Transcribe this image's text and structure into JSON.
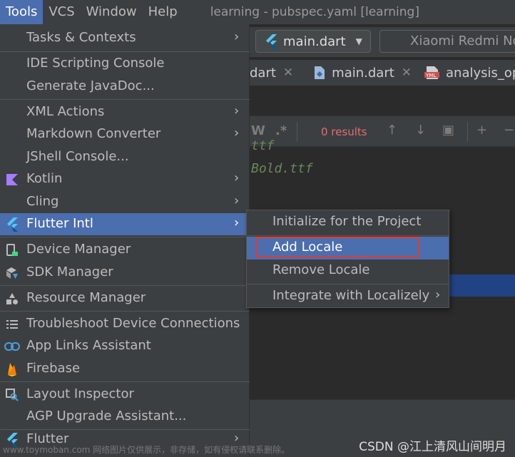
{
  "menubar": {
    "items": [
      "Tools",
      "VCS",
      "Window",
      "Help"
    ],
    "title": "learning - pubspec.yaml [learning]"
  },
  "toolbar": {
    "run_config": "main.dart",
    "device": "Xiaomi Redmi Note"
  },
  "tabs": [
    {
      "label": "dart",
      "icon": "dart-file-icon"
    },
    {
      "label": "main.dart",
      "icon": "dart-file-icon"
    },
    {
      "label": "analysis_opt",
      "icon": "yml-file-icon"
    }
  ],
  "findbar": {
    "words_toggle": "W",
    "regex_toggle": ".*",
    "results": "0 results"
  },
  "editor": {
    "line1": "ttf",
    "line2": "Bold.ttf"
  },
  "tools_menu": {
    "items": [
      {
        "label": "Tasks & Contexts",
        "submenu": true,
        "icon": ""
      },
      {
        "label": "IDE Scripting Console",
        "submenu": false,
        "icon": ""
      },
      {
        "label": "Generate JavaDoc...",
        "submenu": false,
        "icon": ""
      },
      {
        "label": "XML Actions",
        "submenu": true,
        "icon": ""
      },
      {
        "label": "Markdown Converter",
        "submenu": true,
        "icon": ""
      },
      {
        "label": "JShell Console...",
        "submenu": false,
        "icon": ""
      },
      {
        "label": "Kotlin",
        "submenu": true,
        "icon": "kotlin-icon"
      },
      {
        "label": "Cling",
        "submenu": true,
        "icon": ""
      },
      {
        "label": "Flutter Intl",
        "submenu": true,
        "icon": "flutter-icon"
      },
      {
        "label": "Device Manager",
        "submenu": false,
        "icon": "device-manager-icon"
      },
      {
        "label": "SDK Manager",
        "submenu": false,
        "icon": "sdk-manager-icon"
      },
      {
        "label": "Resource Manager",
        "submenu": false,
        "icon": "resource-manager-icon"
      },
      {
        "label": "Troubleshoot Device Connections",
        "submenu": false,
        "icon": "list-icon"
      },
      {
        "label": "App Links Assistant",
        "submenu": false,
        "icon": "link-icon"
      },
      {
        "label": "Firebase",
        "submenu": false,
        "icon": "firebase-icon"
      },
      {
        "label": "Layout Inspector",
        "submenu": false,
        "icon": "layout-inspector-icon"
      },
      {
        "label": "AGP Upgrade Assistant...",
        "submenu": false,
        "icon": ""
      },
      {
        "label": "Flutter",
        "submenu": true,
        "icon": "flutter-icon"
      }
    ]
  },
  "flutter_intl_submenu": {
    "items": [
      {
        "label": "Initialize for the Project",
        "submenu": false
      },
      {
        "label": "Add Locale",
        "submenu": false
      },
      {
        "label": "Remove Locale",
        "submenu": false
      },
      {
        "label": "Integrate with Localizely",
        "submenu": true
      }
    ]
  },
  "watermark": {
    "left": "www.toymoban.com 网络图片仅供展示，非存储，如有侵权请联系删除。",
    "right": "CSDN @江上清风山间明月"
  },
  "colors": {
    "menu_bg": "#3c3f41",
    "selection": "#4b6eaf",
    "highlight_border": "#e53935",
    "editor_bg": "#2b2b2b"
  }
}
